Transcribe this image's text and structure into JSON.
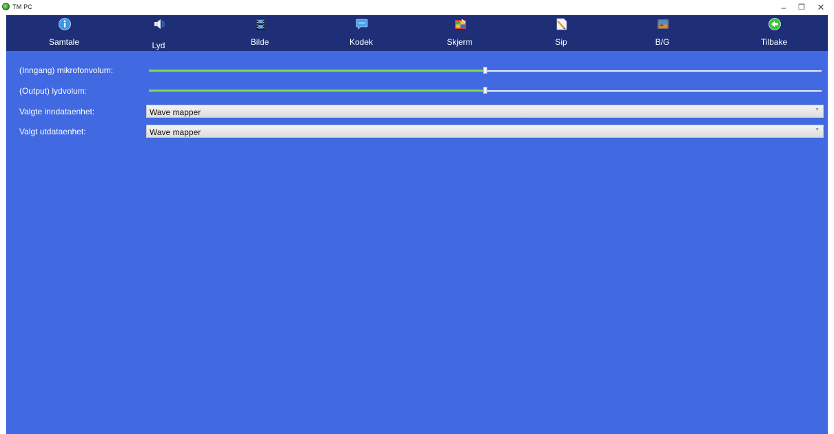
{
  "window": {
    "title": "TM PC",
    "minimize_glyph": "–",
    "restore_glyph": "❐",
    "close_glyph": "✕"
  },
  "toolbar": {
    "items": [
      {
        "label": "Samtale",
        "icon": "info-icon"
      },
      {
        "label": "Lyd",
        "icon": "speaker-icon"
      },
      {
        "label": "Bilde",
        "icon": "film-icon"
      },
      {
        "label": "Kodek",
        "icon": "codec-icon"
      },
      {
        "label": "Skjerm",
        "icon": "screen-icon"
      },
      {
        "label": "Sip",
        "icon": "pencil-icon"
      },
      {
        "label": "B/G",
        "icon": "background-image-icon"
      },
      {
        "label": "Tilbake",
        "icon": "back-arrow-icon"
      }
    ]
  },
  "settings": {
    "mic_volume": {
      "label": "(Inngang) mikrofonvolum:",
      "level": 0.5
    },
    "output_volume": {
      "label": "(Output) lydvolum:",
      "level": 0.5
    },
    "input_device": {
      "label": "Valgte inndataenhet:",
      "value": "Wave mapper"
    },
    "output_device": {
      "label": "Valgt utdataenhet:",
      "value": "Wave mapper"
    }
  },
  "colors": {
    "toolbar_bg": "#1e2f78",
    "content_bg": "#4169e1",
    "slider_fill": "#7ed957"
  }
}
